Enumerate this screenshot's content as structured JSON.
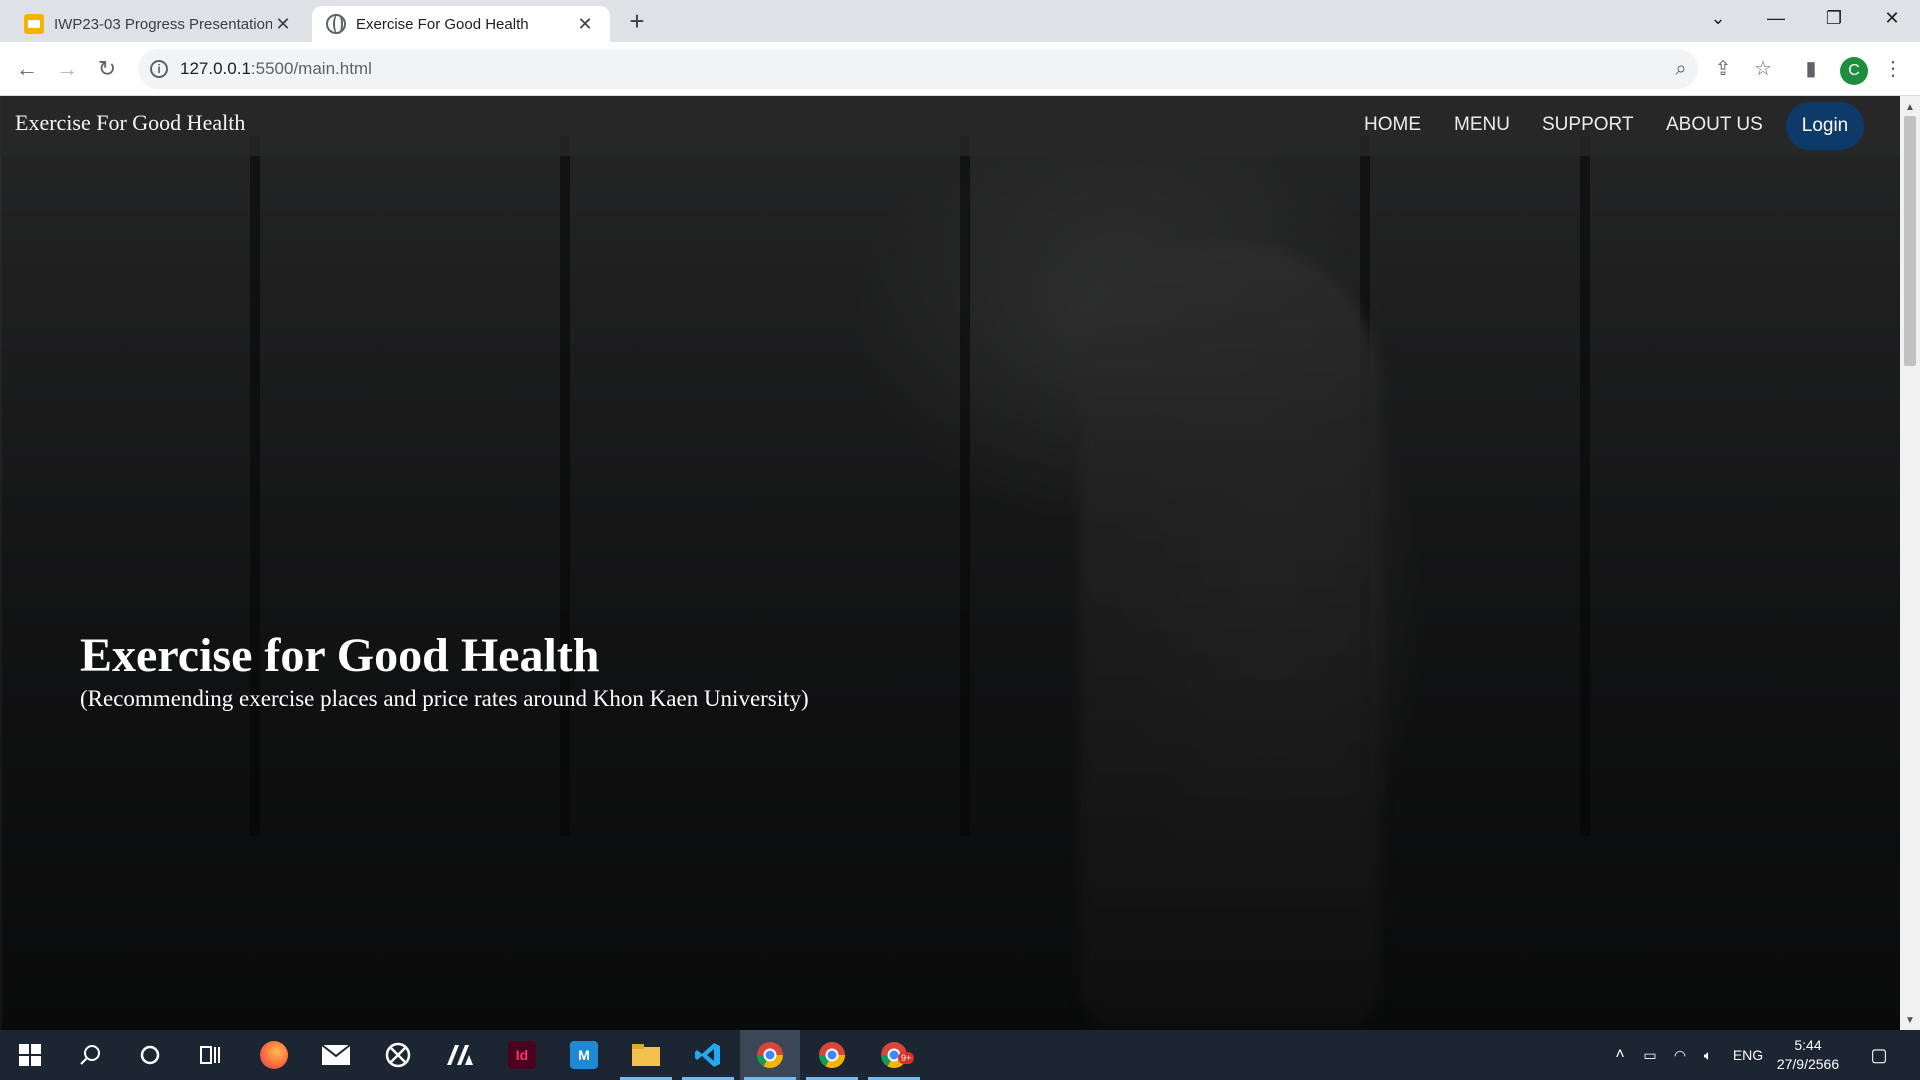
{
  "browser": {
    "tabs": [
      {
        "title": "IWP23-03 Progress Presentation",
        "favicon": "slides-icon"
      },
      {
        "title": "Exercise For Good Health",
        "favicon": "globe-icon"
      }
    ],
    "url_host": "127.0.0.1",
    "url_path": ":5500/main.html",
    "profile_initial": "C"
  },
  "site": {
    "brand": "Exercise For Good Health",
    "nav": {
      "home": "HOME",
      "menu": "MENU",
      "support": "SUPPORT",
      "about": "ABOUT US",
      "login": "Login"
    },
    "hero": {
      "title": "Exercise for Good Health",
      "subtitle": "(Recommending exercise places and price rates around Khon Kaen University)"
    }
  },
  "taskbar": {
    "apps": [
      "windows-start-icon",
      "search-icon",
      "cortana-icon",
      "task-view-icon",
      "firefox-icon",
      "mail-icon",
      "xbox-icon",
      "ata-icon",
      "indesign-icon",
      "mata-icon",
      "file-explorer-icon",
      "vscode-icon",
      "chrome-icon",
      "chrome-icon",
      "chrome-icon"
    ],
    "indesign_label": "Id",
    "mata_label": "M",
    "language": "ENG",
    "time": "5:44",
    "date": "27/9/2566",
    "badge": "9+"
  },
  "colors": {
    "login_bg": "#0d3a68",
    "taskbar_bg": "#1c2633",
    "profile_bg": "#1e8e3e"
  }
}
